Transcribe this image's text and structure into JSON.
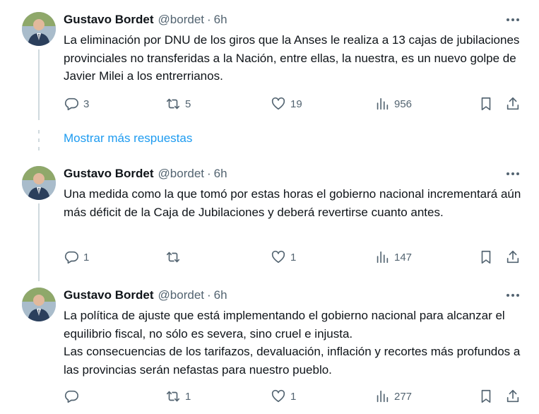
{
  "tweets": [
    {
      "name": "Gustavo Bordet",
      "handle": "@bordet",
      "sep": "·",
      "time": "6h",
      "text": "La eliminación por DNU de los giros que la Anses le realiza a 13 cajas de jubilaciones provinciales no transferidas a la Nación, entre ellas, la nuestra, es un nuevo golpe de Javier Milei a los entrerrianos.",
      "replies": "3",
      "retweets": "5",
      "likes": "19",
      "views": "956"
    },
    {
      "name": "Gustavo Bordet",
      "handle": "@bordet",
      "sep": "·",
      "time": "6h",
      "text": "Una medida como la que tomó por estas horas el gobierno nacional incrementará aún más déficit de la Caja de Jubilaciones y deberá revertirse cuanto antes.",
      "replies": "1",
      "retweets": "",
      "likes": "1",
      "views": "147"
    },
    {
      "name": "Gustavo Bordet",
      "handle": "@bordet",
      "sep": "·",
      "time": "6h",
      "text_lines": [
        "La política de ajuste que está implementando el gobierno nacional para alcanzar el equilibrio fiscal, no sólo es severa, sino cruel e injusta.",
        "Las consecuencias de los tarifazos, devaluación, inflación y recortes más profundos a las provincias serán nefastas para nuestro pueblo."
      ],
      "replies": "",
      "retweets": "1",
      "likes": "1",
      "views": "277"
    }
  ],
  "show_more_label": "Mostrar más respuestas",
  "icons": {
    "more": "more-icon",
    "reply": "reply-icon",
    "retweet": "retweet-icon",
    "like": "like-icon",
    "views": "views-icon",
    "bookmark": "bookmark-icon",
    "share": "share-icon"
  },
  "colors": {
    "link": "#1d9bf0",
    "secondary_text": "#536471",
    "thread_line": "#cfd9de"
  }
}
